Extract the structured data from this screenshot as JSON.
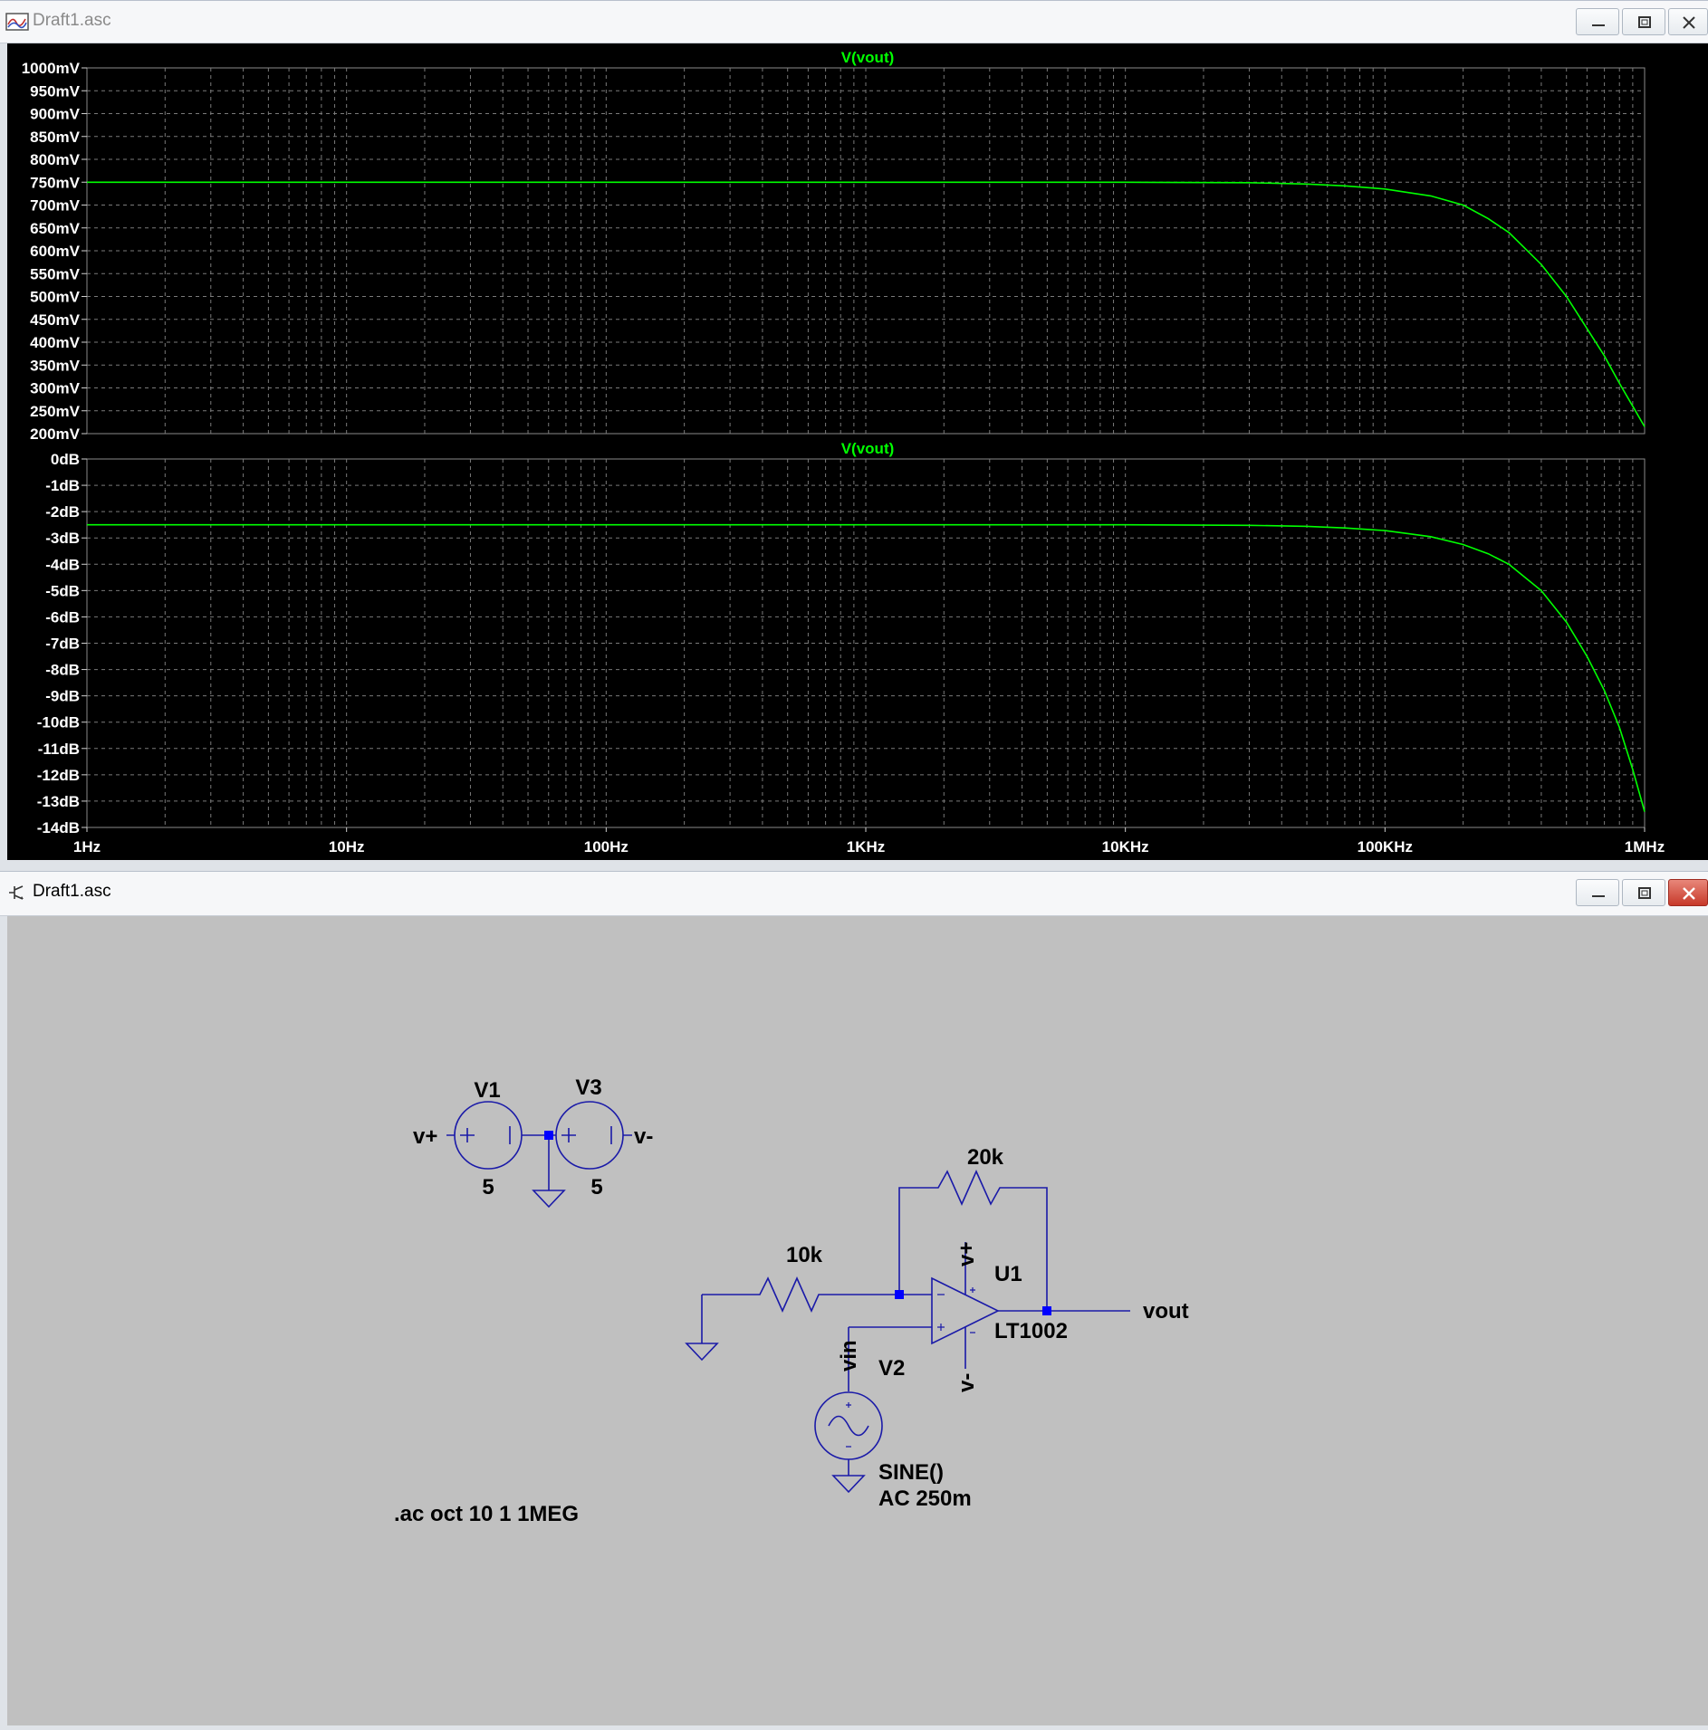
{
  "plot_window": {
    "title": "Draft1.asc",
    "title_color": "#8a8a8a",
    "icon": "waveform-plot-icon",
    "controls": [
      "minimize-icon",
      "maximize-icon",
      "close-icon"
    ]
  },
  "schematic_window": {
    "title": "Draft1.asc",
    "title_color": "#000000",
    "icon": "schematic-icon",
    "controls": [
      "minimize-icon",
      "maximize-icon",
      "close-icon"
    ],
    "labels": {
      "v1_name": "V1",
      "v1_value": "5",
      "v3_name": "V3",
      "v3_value": "5",
      "vplus_net": "v+",
      "vminus_net": "v-",
      "r_feedback": "20k",
      "r_input": "10k",
      "u1_name": "U1",
      "u1_model": "LT1002",
      "u1_vplus": "v+",
      "u1_vminus": "v-",
      "vout_net": "vout",
      "vin_net": "vin",
      "v2_name": "V2",
      "v2_func": "SINE()",
      "v2_ac": "AC 250m",
      "directive": ".ac oct 10 1 1MEG"
    }
  },
  "chart_data": [
    {
      "type": "line",
      "title": "V(vout)",
      "xscale": "log",
      "xlim": [
        1,
        1000000
      ],
      "ylim": [
        200,
        1000
      ],
      "yunit": "mV",
      "yticks": [
        "1000mV",
        "950mV",
        "900mV",
        "850mV",
        "800mV",
        "750mV",
        "700mV",
        "650mV",
        "600mV",
        "550mV",
        "500mV",
        "450mV",
        "400mV",
        "350mV",
        "300mV",
        "250mV",
        "200mV"
      ],
      "grid": true,
      "colors": {
        "trace": "#00ff00",
        "title": "#00ff00",
        "grid": "#7a7a7a",
        "background": "#000000",
        "axis_text": "#ffffff"
      },
      "series": [
        {
          "name": "V(vout)",
          "x": [
            1,
            10,
            100,
            1000,
            10000,
            30000,
            50000,
            70000,
            100000,
            150000,
            200000,
            250000,
            300000,
            400000,
            500000,
            600000,
            700000,
            800000,
            900000,
            1000000
          ],
          "y": [
            750,
            750,
            750,
            750,
            750,
            749,
            746,
            742,
            735,
            720,
            700,
            670,
            640,
            570,
            500,
            430,
            370,
            310,
            260,
            215
          ]
        }
      ]
    },
    {
      "type": "line",
      "title": "V(vout)",
      "xscale": "log",
      "xlim": [
        1,
        1000000
      ],
      "ylim": [
        -14,
        0
      ],
      "yunit": "dB",
      "yticks": [
        "0dB",
        "-1dB",
        "-2dB",
        "-3dB",
        "-4dB",
        "-5dB",
        "-6dB",
        "-7dB",
        "-8dB",
        "-9dB",
        "-10dB",
        "-11dB",
        "-12dB",
        "-13dB",
        "-14dB"
      ],
      "xticks": [
        "1Hz",
        "10Hz",
        "100Hz",
        "1KHz",
        "10KHz",
        "100KHz",
        "1MHz"
      ],
      "grid": true,
      "series": [
        {
          "name": "V(vout)",
          "x": [
            1,
            10,
            100,
            1000,
            10000,
            30000,
            50000,
            70000,
            100000,
            150000,
            200000,
            250000,
            300000,
            400000,
            500000,
            600000,
            700000,
            800000,
            900000,
            1000000
          ],
          "y": [
            -2.5,
            -2.5,
            -2.5,
            -2.5,
            -2.5,
            -2.52,
            -2.56,
            -2.62,
            -2.72,
            -2.95,
            -3.25,
            -3.6,
            -4.0,
            -5.0,
            -6.2,
            -7.5,
            -8.8,
            -10.2,
            -11.8,
            -13.4
          ]
        }
      ]
    }
  ]
}
